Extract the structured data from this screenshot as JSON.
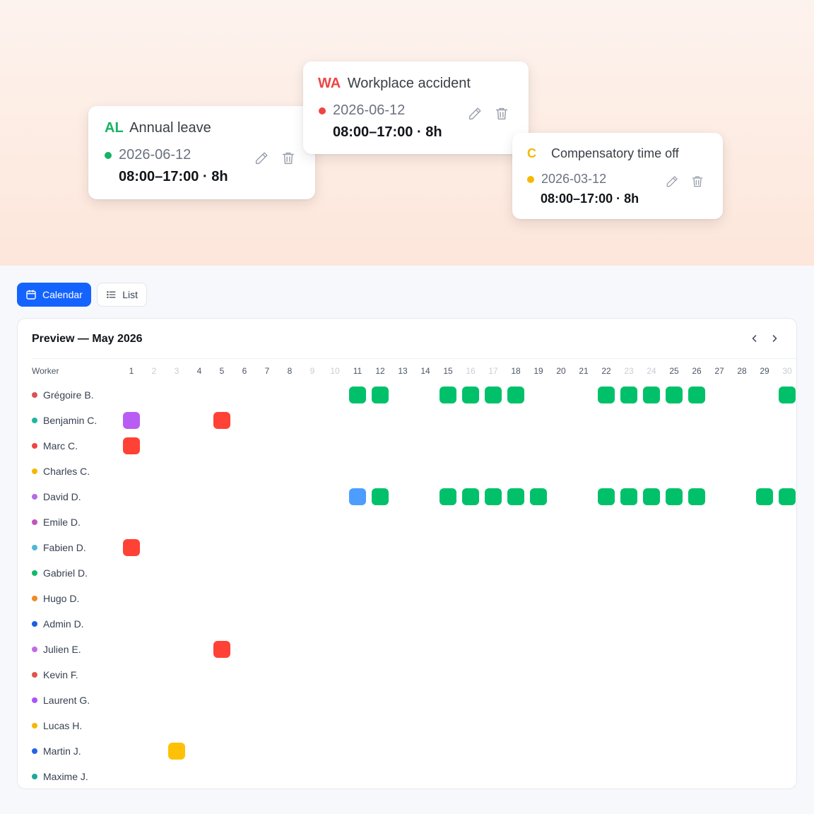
{
  "hero": {
    "cards": [
      {
        "code": "AL",
        "title": "Annual leave",
        "date": "2026-06-12",
        "time": "08:00–17:00 · 8h",
        "color": "#16b364"
      },
      {
        "code": "WA",
        "title": "Workplace accident",
        "date": "2026-06-12",
        "time": "08:00–17:00 · 8h",
        "color": "#ef4444"
      },
      {
        "code": "C",
        "title": "Compensatory time off",
        "date": "2026-03-12",
        "time": "08:00–17:00 · 8h",
        "color": "#f5b800"
      }
    ],
    "edit_icon": "pencil-icon",
    "delete_icon": "trash-icon"
  },
  "toolbar": {
    "calendar_label": "Calendar",
    "list_label": "List",
    "active_view": "Calendar",
    "accent": "#1463ff"
  },
  "panel": {
    "title": "Preview — May 2026",
    "worker_header": "Worker",
    "days": [
      1,
      2,
      3,
      4,
      5,
      6,
      7,
      8,
      9,
      10,
      11,
      12,
      13,
      14,
      15,
      16,
      17,
      18,
      19,
      20,
      21,
      22,
      23,
      24,
      25,
      26,
      27,
      28,
      29,
      30
    ],
    "weekend_days": [
      2,
      3,
      9,
      10,
      16,
      17,
      23,
      24,
      30
    ],
    "colors": {
      "green": "#00c16a",
      "red": "#ff4136",
      "purple": "#b95cf4",
      "blue": "#4d9dff",
      "yellow": "#ffc107"
    },
    "workers": [
      {
        "name": "Grégoire B.",
        "dot": "#d9534f",
        "cells": [
          [
            11,
            "green"
          ],
          [
            12,
            "green"
          ],
          [
            15,
            "green"
          ],
          [
            16,
            "green"
          ],
          [
            17,
            "green"
          ],
          [
            18,
            "green"
          ],
          [
            22,
            "green"
          ],
          [
            23,
            "green"
          ],
          [
            24,
            "green"
          ],
          [
            25,
            "green"
          ],
          [
            26,
            "green"
          ],
          [
            30,
            "green"
          ]
        ]
      },
      {
        "name": "Benjamin C.",
        "dot": "#1fb5a0",
        "cells": [
          [
            1,
            "purple"
          ],
          [
            5,
            "red"
          ]
        ]
      },
      {
        "name": "Marc C.",
        "dot": "#ef4444",
        "cells": [
          [
            1,
            "red"
          ]
        ]
      },
      {
        "name": "Charles C.",
        "dot": "#f5b800",
        "cells": []
      },
      {
        "name": "David D.",
        "dot": "#b46be8",
        "cells": [
          [
            11,
            "blue"
          ],
          [
            12,
            "green"
          ],
          [
            15,
            "green"
          ],
          [
            16,
            "green"
          ],
          [
            17,
            "green"
          ],
          [
            18,
            "green"
          ],
          [
            19,
            "green"
          ],
          [
            22,
            "green"
          ],
          [
            23,
            "green"
          ],
          [
            24,
            "green"
          ],
          [
            25,
            "green"
          ],
          [
            26,
            "green"
          ],
          [
            29,
            "green"
          ],
          [
            30,
            "green"
          ]
        ]
      },
      {
        "name": "Emile D.",
        "dot": "#c054c0",
        "cells": []
      },
      {
        "name": "Fabien D.",
        "dot": "#4fb8d4",
        "cells": [
          [
            1,
            "red"
          ]
        ]
      },
      {
        "name": "Gabriel D.",
        "dot": "#14b86a",
        "cells": []
      },
      {
        "name": "Hugo D.",
        "dot": "#f08a24",
        "cells": []
      },
      {
        "name": "Admin D.",
        "dot": "#1a5fe0",
        "cells": []
      },
      {
        "name": "Julien E.",
        "dot": "#c06ae8",
        "cells": [
          [
            5,
            "red"
          ]
        ]
      },
      {
        "name": "Kevin F.",
        "dot": "#e0544c",
        "cells": []
      },
      {
        "name": "Laurent G.",
        "dot": "#a855f7",
        "cells": []
      },
      {
        "name": "Lucas H.",
        "dot": "#f5b800",
        "cells": []
      },
      {
        "name": "Martin J.",
        "dot": "#2563eb",
        "cells": [
          [
            3,
            "yellow"
          ]
        ]
      },
      {
        "name": "Maxime J.",
        "dot": "#1fa89a",
        "cells": []
      }
    ]
  }
}
